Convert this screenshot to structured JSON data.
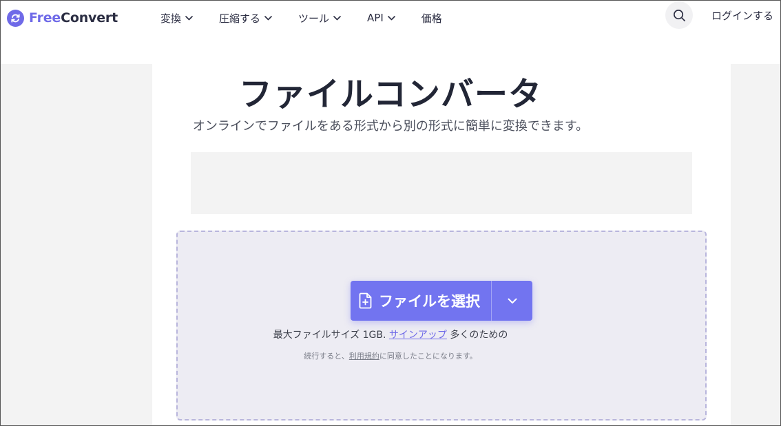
{
  "header": {
    "logo_free": "Free",
    "logo_convert": "Convert",
    "nav": [
      {
        "label": "変換",
        "icon": "chevron-down-icon"
      },
      {
        "label": "圧縮する",
        "icon": "chevron-down-icon"
      },
      {
        "label": "ツール",
        "icon": "chevron-down-icon"
      },
      {
        "label": "API",
        "icon": "chevron-down-icon"
      },
      {
        "label": "価格"
      }
    ],
    "search_icon": "search-icon",
    "login_label": "ログインする"
  },
  "hero": {
    "title": "ファイルコンバータ",
    "subtitle": "オンラインでファイルをある形式から別の形式に簡単に変換できます。"
  },
  "upload": {
    "choose_label": "ファイルを選択",
    "choose_icon": "file-plus-icon",
    "dropdown_icon": "chevron-down-icon",
    "limit_prefix": "最大ファイルサイズ 1GB.",
    "signup_link": "サインアップ",
    "limit_suffix": "多くのための",
    "terms_prefix": "続行すると、",
    "terms_link": "利用規約",
    "terms_suffix": "に同意したことになります。"
  },
  "colors": {
    "brand": "#6f6ae8",
    "button": "#7274f0",
    "dropzone_bg": "#edecf3",
    "dropzone_border": "#b8b5dc"
  }
}
